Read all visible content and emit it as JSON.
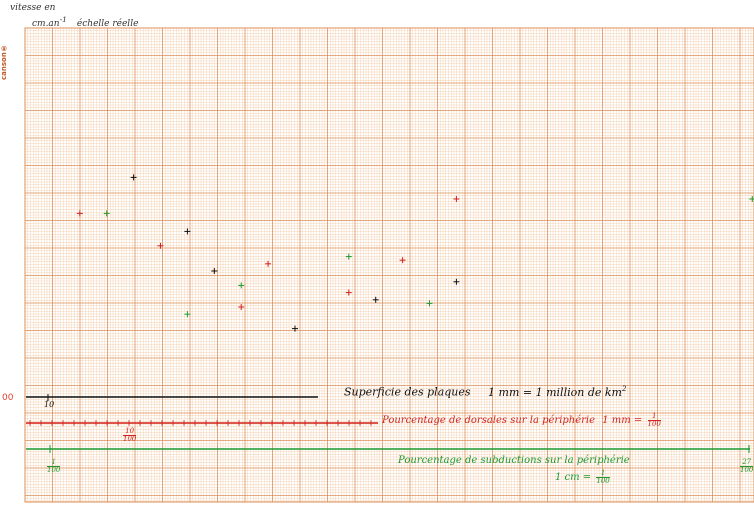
{
  "header": {
    "ylabel_line1": "vitesse en",
    "ylabel_line2": "cm.an",
    "ylabel_sup": "-1",
    "ylabel_scale": "échelle réelle"
  },
  "brand": {
    "text": "canson®"
  },
  "origin_mark": "00",
  "colors": {
    "paper_minor": "#f3c9a4",
    "paper_major": "#dc8f5a",
    "ink_black": "#111111",
    "ink_red": "#d2231d",
    "ink_green": "#1c9a2f",
    "ink_blue": "#1b2a7a"
  },
  "axes": {
    "black": {
      "label": "Superficie des plaques",
      "scale": "1 mm = 1 million de km",
      "scale_sup": "2",
      "tick_label": "10"
    },
    "red": {
      "label": "Pourcentage de dorsales sur la périphérie",
      "scale_prefix": "1 mm =",
      "scale_num": "1",
      "scale_den": "100",
      "tick_num": "10",
      "tick_den": "100"
    },
    "green": {
      "label": "Pourcentage de subductions sur la périphérie",
      "scale_prefix": "1 cm =",
      "scale_num": "1",
      "scale_den": "100",
      "tick_num": "1",
      "tick_den": "100",
      "end_num": "27",
      "end_den": "100"
    }
  },
  "chart_data": {
    "type": "scatter",
    "xlabel": "",
    "ylabel": "vitesse en cm.an-1",
    "grid": true,
    "series": [
      {
        "color": "#111111",
        "points": [
          [
            4,
            6.1
          ],
          [
            6,
            4.6
          ],
          [
            7,
            3.5
          ],
          [
            10,
            1.9
          ],
          [
            13,
            2.7
          ],
          [
            16,
            3.2
          ]
        ]
      },
      {
        "color": "#d2231d",
        "points": [
          [
            2,
            5.1
          ],
          [
            5,
            4.2
          ],
          [
            8,
            2.5
          ],
          [
            9,
            3.7
          ],
          [
            12,
            2.9
          ],
          [
            14,
            3.8
          ],
          [
            16,
            5.5
          ]
        ]
      },
      {
        "color": "#1c9a2f",
        "points": [
          [
            3,
            5.1
          ],
          [
            6,
            2.3
          ],
          [
            8,
            3.1
          ],
          [
            12,
            3.9
          ],
          [
            15,
            2.6
          ],
          [
            27,
            5.5
          ]
        ]
      }
    ]
  }
}
